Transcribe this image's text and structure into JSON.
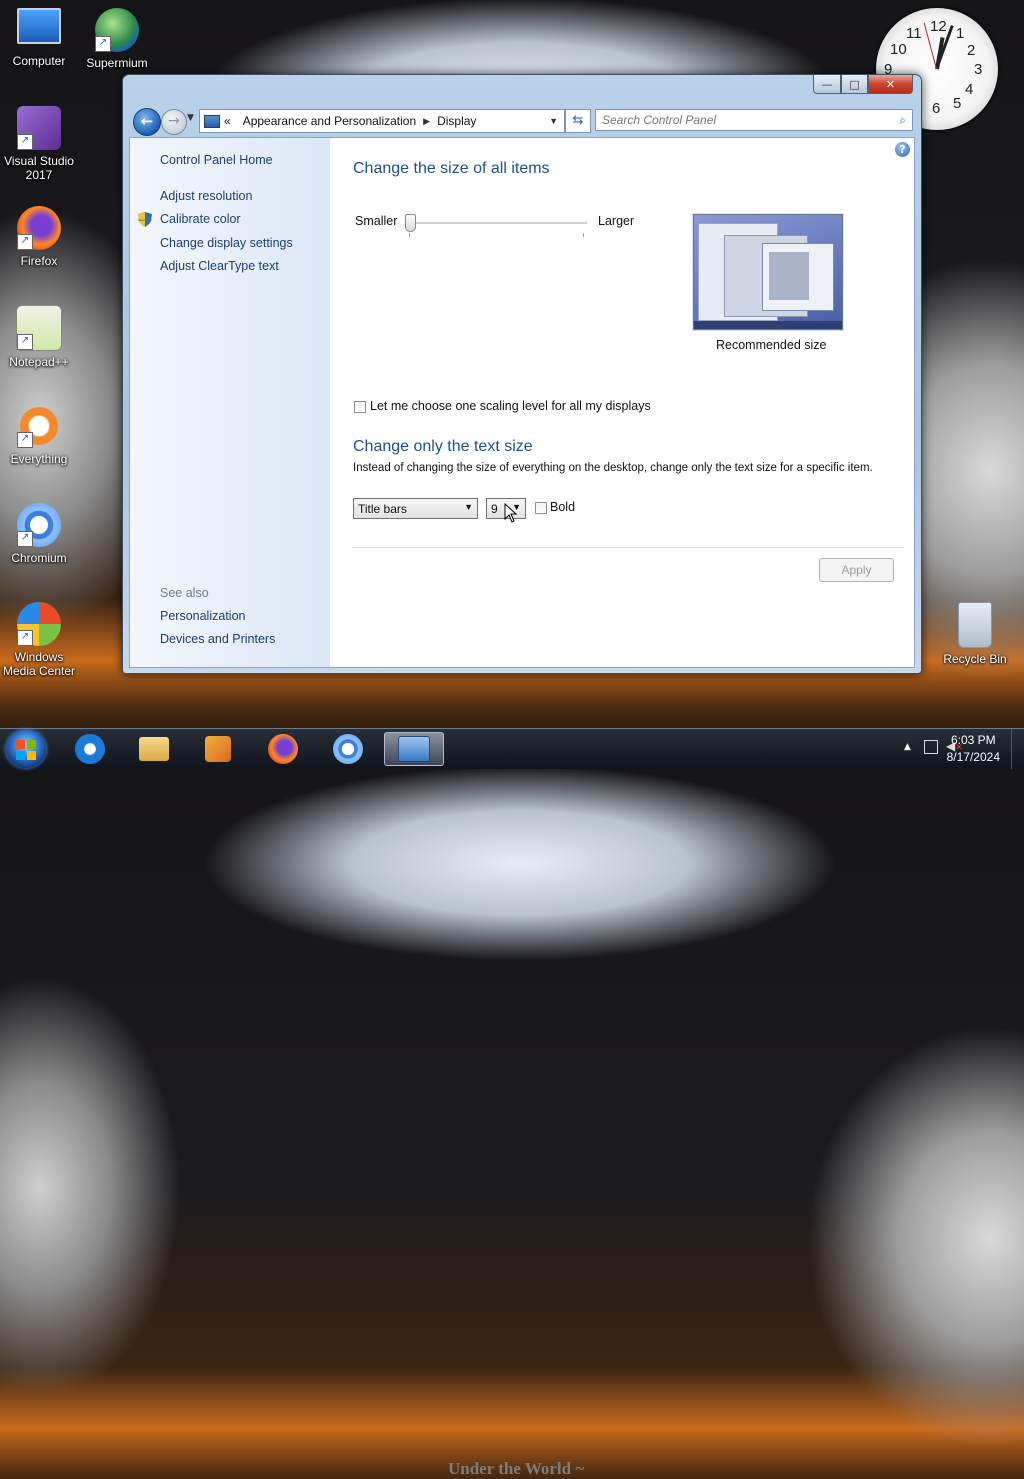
{
  "desktop": {
    "icons": [
      {
        "label": "Computer"
      },
      {
        "label": "Supermium"
      },
      {
        "label_line1": "Visual Studio",
        "label_line2": "2017"
      },
      {
        "label": "Firefox"
      },
      {
        "label": "Notepad++"
      },
      {
        "label": "Everything"
      },
      {
        "label": "Chromium"
      },
      {
        "label_line1": "Windows",
        "label_line2": "Media Center"
      },
      {
        "label": "Recycle Bin"
      }
    ],
    "wallpaper_text": "Under the World ~",
    "clock_gadget": {
      "numbers": [
        "12",
        "1",
        "2",
        "3",
        "4",
        "5",
        "6",
        "9",
        "10",
        "11"
      ]
    }
  },
  "window": {
    "controls": {
      "minimize": "—",
      "maximize": "□",
      "close": "✕"
    },
    "address": {
      "overflow": "«",
      "crumbs": [
        "Appearance and Personalization",
        "Display"
      ]
    },
    "search": {
      "placeholder": "Search Control Panel"
    },
    "sidebar": {
      "home": "Control Panel Home",
      "links": [
        "Adjust resolution",
        "Calibrate color",
        "Change display settings",
        "Adjust ClearType text"
      ],
      "see_also_title": "See also",
      "see_also": [
        "Personalization",
        "Devices and Printers"
      ]
    },
    "main": {
      "size_heading": "Change the size of all items",
      "slider": {
        "min_label": "Smaller",
        "max_label": "Larger",
        "value_fraction": 0.0
      },
      "preview_caption": "Recommended size",
      "scaling_checkbox": {
        "label": "Let me choose one scaling level for all my displays",
        "checked": false
      },
      "text_heading": "Change only the text size",
      "text_description": "Instead of changing the size of everything on the desktop, change only the text size for a specific item.",
      "item_select": {
        "value": "Title bars"
      },
      "size_select": {
        "value": "9"
      },
      "bold_checkbox": {
        "label": "Bold",
        "checked": false
      },
      "apply_label": "Apply"
    }
  },
  "taskbar": {
    "time": "6:03 PM",
    "date": "8/17/2024"
  },
  "colors": {
    "link": "#1e3e70",
    "heading": "#1e4f91",
    "close_button": "#c9432c"
  }
}
